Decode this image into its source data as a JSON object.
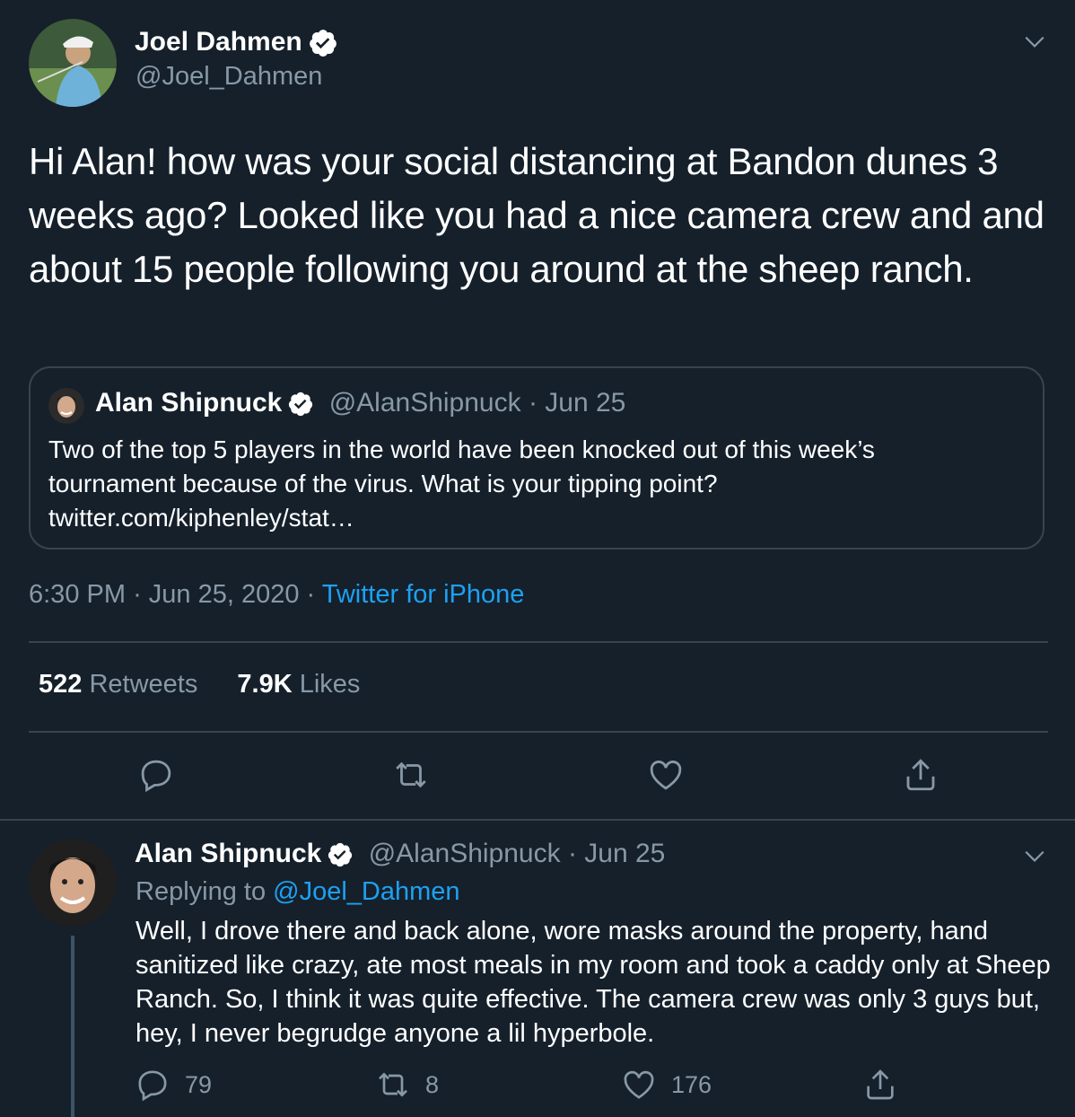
{
  "main_tweet": {
    "author_name": "Joel Dahmen",
    "author_handle": "@Joel_Dahmen",
    "text": "Hi Alan! how was your social distancing at Bandon dunes 3 weeks ago? Looked like you had a nice camera crew and and about 15 people following you around at the sheep ranch.",
    "quoted": {
      "author_name": "Alan Shipnuck",
      "author_handle": "@AlanShipnuck",
      "date": "· Jun 25",
      "text": "Two of the top 5 players in the world have been knocked out of this week’s tournament because of the virus. What is your tipping point? twitter.com/kiphenley/stat…"
    },
    "time": "6:30 PM",
    "date": "· Jun 25, 2020 ·",
    "source": "Twitter for iPhone",
    "retweets_count": "522",
    "retweets_label": "Retweets",
    "likes_count": "7.9K",
    "likes_label": "Likes"
  },
  "reply": {
    "author_name": "Alan Shipnuck",
    "author_handle": "@AlanShipnuck",
    "date": "· Jun 25",
    "replying_prefix": "Replying to",
    "replying_handle": "@Joel_Dahmen",
    "text": "Well, I drove there and back alone, wore masks around the property, hand sanitized like crazy, ate most meals in my room  and took a caddy only at Sheep Ranch. So, I think it was quite effective. The camera crew was only 3 guys but, hey, I never begrudge anyone a lil hyperbole.",
    "replies": "79",
    "retweets": "8",
    "likes": "176"
  },
  "colors": {
    "background": "#15202b",
    "muted": "#8899a6",
    "accent": "#1da1f2",
    "divider": "#38444d"
  }
}
